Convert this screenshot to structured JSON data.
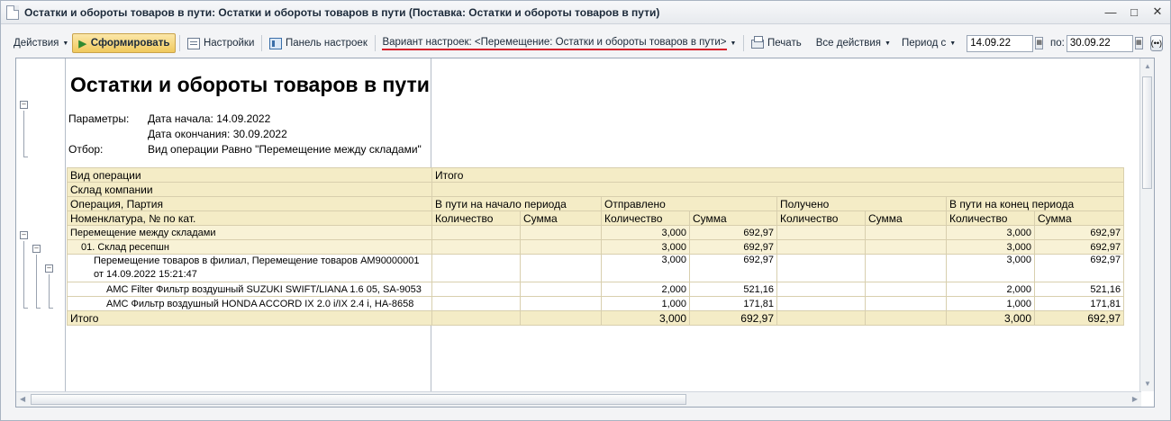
{
  "window": {
    "title": "Остатки и обороты товаров в пути: Остатки и обороты товаров в пути (Поставка: Остатки и обороты товаров в пути)",
    "controls": [
      "minimize",
      "restore",
      "close"
    ]
  },
  "toolbar": {
    "actions_label": "Действия",
    "generate_label": "Сформировать",
    "settings_label": "Настройки",
    "panel_label": "Панель настроек",
    "variant_label": "Вариант настроек: <Перемещение: Остатки и обороты товаров в пути>",
    "print_label": "Печать",
    "all_actions_label": "Все действия",
    "period_from_label": "Период с",
    "date_from": "14.09.22",
    "to_label": "по:",
    "date_to": "30.09.22",
    "period_button": "(••)"
  },
  "report": {
    "title": "Остатки и обороты товаров в пути",
    "params_label": "Параметры:",
    "start_date": "Дата начала: 14.09.2022",
    "end_date": "Дата окончания: 30.09.2022",
    "filter_label": "Отбор:",
    "filter_value": "Вид операции Равно \"Перемещение между складами\"",
    "headers": {
      "op_type": "Вид операции",
      "warehouse": "Склад компании",
      "operation": "Операция, Партия",
      "nomenclature": "Номенклатура, № по кат.",
      "total": "Итого",
      "begin": "В пути на начало периода",
      "sent": "Отправлено",
      "received": "Получено",
      "end": "В пути на конец периода",
      "qty": "Количество",
      "sum": "Сумма"
    },
    "rows": [
      {
        "label": "Перемещение между складами",
        "sent_qty": "3,000",
        "sent_sum": "692,97",
        "end_qty": "3,000",
        "end_sum": "692,97"
      },
      {
        "label": "01. Склад ресепшн",
        "sent_qty": "3,000",
        "sent_sum": "692,97",
        "end_qty": "3,000",
        "end_sum": "692,97"
      },
      {
        "label": "Перемещение товаров в филиал, Перемещение товаров АМ90000001",
        "label2": "от 14.09.2022 15:21:47",
        "sent_qty": "3,000",
        "sent_sum": "692,97",
        "end_qty": "3,000",
        "end_sum": "692,97"
      },
      {
        "label": "AMC Filter Фильтр воздушный SUZUKI SWIFT/LIANA 1.6 05, SA-9053",
        "sent_qty": "2,000",
        "sent_sum": "521,16",
        "end_qty": "2,000",
        "end_sum": "521,16"
      },
      {
        "label": "AMC Фильтр воздушный HONDA ACCORD IX 2.0 i/IX 2.4 i, HA-8658",
        "sent_qty": "1,000",
        "sent_sum": "171,81",
        "end_qty": "1,000",
        "end_sum": "171,81"
      }
    ],
    "total": {
      "label": "Итого",
      "sent_qty": "3,000",
      "sent_sum": "692,97",
      "end_qty": "3,000",
      "end_sum": "692,97"
    }
  }
}
